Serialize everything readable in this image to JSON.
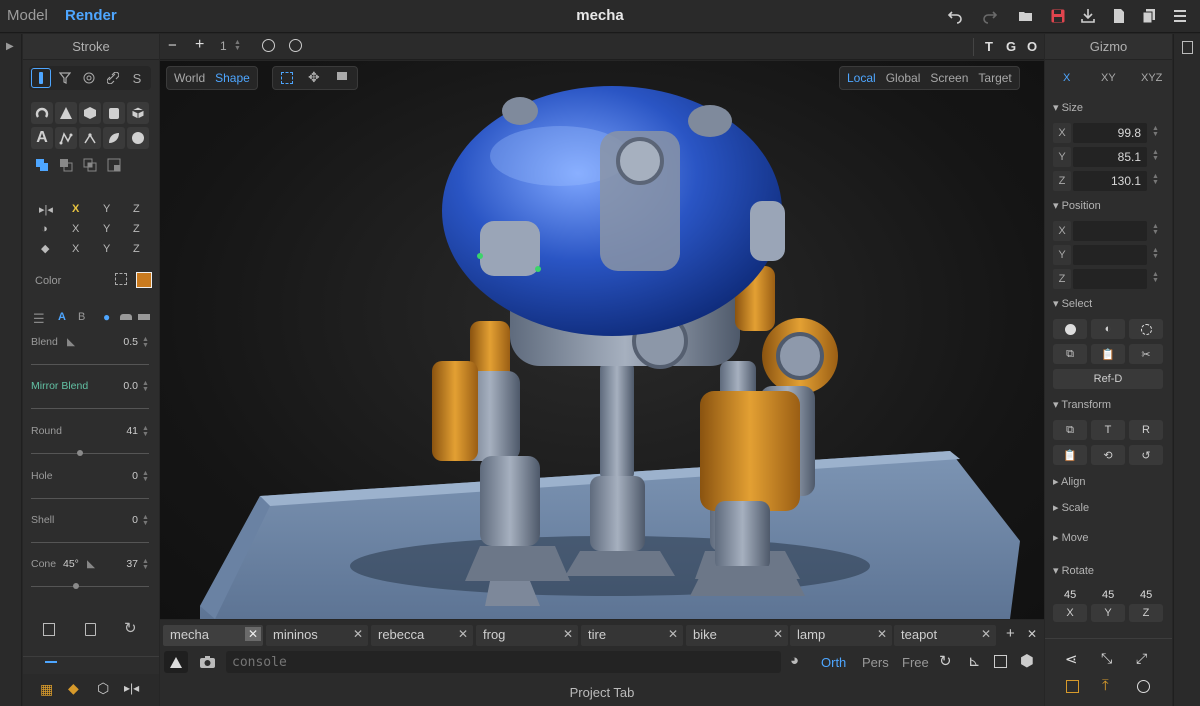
{
  "header": {
    "mode_model": "Model",
    "mode_render": "Render",
    "title": "mecha"
  },
  "left": {
    "title": "Stroke",
    "tool_tabs": [
      "stroke-tool-icon",
      "lasso-tool-icon",
      "target-tool-icon",
      "link-tool-icon",
      "curve-tool-icon"
    ],
    "curve_label": "S",
    "mirror": {
      "x": "X",
      "y": "Y",
      "z": "Z"
    },
    "color_label": "Color",
    "color_value": "#c97a1e",
    "ab": {
      "a": "A",
      "b": "B"
    },
    "params": [
      {
        "label": "Blend",
        "value": "0.5"
      },
      {
        "label": "Mirror Blend",
        "value": "0.0"
      },
      {
        "label": "Round",
        "value": "41"
      },
      {
        "label": "Hole",
        "value": "0"
      },
      {
        "label": "Shell",
        "value": "0"
      },
      {
        "label": "Cone",
        "extra": "45°",
        "value": "37"
      }
    ]
  },
  "viewport_toolbar": {
    "minus": "−",
    "plus": "+",
    "count": "1",
    "t": "T",
    "g": "G",
    "o": "O"
  },
  "viewport": {
    "space_world": "World",
    "space_shape": "Shape",
    "gizmo_local": "Local",
    "gizmo_global": "Global",
    "gizmo_screen": "Screen",
    "gizmo_target": "Target"
  },
  "right": {
    "title": "Gizmo",
    "axes": [
      "X",
      "XY",
      "XYZ"
    ],
    "size": {
      "title": "Size",
      "x": "99.8",
      "y": "85.1",
      "z": "130.1"
    },
    "position": {
      "title": "Position",
      "x": "",
      "y": "",
      "z": ""
    },
    "axis_x": "X",
    "axis_y": "Y",
    "axis_z": "Z",
    "select_title": "Select",
    "refd": "Ref-D",
    "transform_title": "Transform",
    "transform_t": "T",
    "transform_r": "R",
    "align": "Align",
    "scale": "Scale",
    "move": "Move",
    "rotate": {
      "title": "Rotate",
      "x": "45",
      "y": "45",
      "z": "45"
    }
  },
  "tabs": [
    "mecha",
    "mininos",
    "rebecca",
    "frog",
    "tire",
    "bike",
    "lamp",
    "teapot"
  ],
  "console": {
    "placeholder": "console"
  },
  "proj": {
    "orth": "Orth",
    "pers": "Pers",
    "free": "Free"
  },
  "project_tab": "Project Tab",
  "colors": {
    "accent": "#4ea6ff",
    "brand_orange": "#d79a2b",
    "save_red": "#e0454e"
  }
}
